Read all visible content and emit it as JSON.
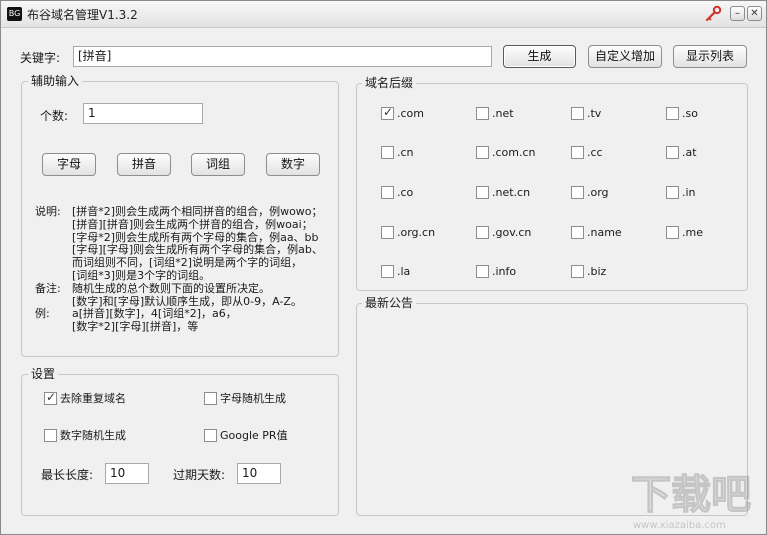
{
  "window": {
    "title": "布谷域名管理V1.3.2",
    "app_icon_text": "BG",
    "minimize_glyph": "–",
    "close_glyph": "✕"
  },
  "keyword": {
    "label": "关键字:",
    "value": "[拼音]"
  },
  "toolbar": {
    "generate": "生成",
    "custom_add": "自定义增加",
    "show_list": "显示列表"
  },
  "aux_input": {
    "title": "辅助输入",
    "count_label": "个数:",
    "count_value": "1",
    "buttons": [
      "字母",
      "拼音",
      "词组",
      "数字"
    ],
    "desc_rows": [
      {
        "label": "说明:",
        "text": "[拼音*2]则会生成两个相同拼音的组合，例wowo；"
      },
      {
        "label": "",
        "text": "[拼音][拼音]则会生成两个拼音的组合，例woai；"
      },
      {
        "label": "",
        "text": "[字母*2]则会生成所有两个字母的集合，例aa、bb"
      },
      {
        "label": "",
        "text": "[字母][字母]则会生成所有两个字母的集合，例ab、"
      },
      {
        "label": "",
        "text": "而词组则不同，[词组*2]说明是两个字的词组，"
      },
      {
        "label": "",
        "text": "[词组*3]则是3个字的词组。"
      },
      {
        "label": "备注:",
        "text": "随机生成的总个数则下面的设置所决定。"
      },
      {
        "label": "",
        "text": "[数字]和[字母]默认顺序生成，即从0-9，A-Z。"
      },
      {
        "label": "例:",
        "text": "a[拼音][数字]，4[词组*2]，a6，"
      },
      {
        "label": "",
        "text": "[数字*2][字母][拼音]，等"
      }
    ]
  },
  "settings": {
    "title": "设置",
    "options": [
      {
        "label": "去除重复域名",
        "checked": true
      },
      {
        "label": "字母随机生成",
        "checked": false
      },
      {
        "label": "数字随机生成",
        "checked": false
      },
      {
        "label": "Google PR值",
        "checked": false
      }
    ],
    "max_length_label": "最长长度:",
    "max_length_value": "10",
    "expire_days_label": "过期天数:",
    "expire_days_value": "10"
  },
  "suffixes": {
    "title": "域名后缀",
    "items": [
      {
        "label": ".com",
        "checked": true
      },
      {
        "label": ".net",
        "checked": false
      },
      {
        "label": ".tv",
        "checked": false
      },
      {
        "label": ".so",
        "checked": false
      },
      {
        "label": ".cn",
        "checked": false
      },
      {
        "label": ".com.cn",
        "checked": false
      },
      {
        "label": ".cc",
        "checked": false
      },
      {
        "label": ".at",
        "checked": false
      },
      {
        "label": ".co",
        "checked": false
      },
      {
        "label": ".net.cn",
        "checked": false
      },
      {
        "label": ".org",
        "checked": false
      },
      {
        "label": ".in",
        "checked": false
      },
      {
        "label": ".org.cn",
        "checked": false
      },
      {
        "label": ".gov.cn",
        "checked": false
      },
      {
        "label": ".name",
        "checked": false
      },
      {
        "label": ".me",
        "checked": false
      },
      {
        "label": ".la",
        "checked": false
      },
      {
        "label": ".info",
        "checked": false
      },
      {
        "label": ".biz",
        "checked": false
      }
    ]
  },
  "announcements": {
    "title": "最新公告"
  },
  "watermark": {
    "text": "下载吧",
    "url": "www.xiazaiba.com"
  }
}
